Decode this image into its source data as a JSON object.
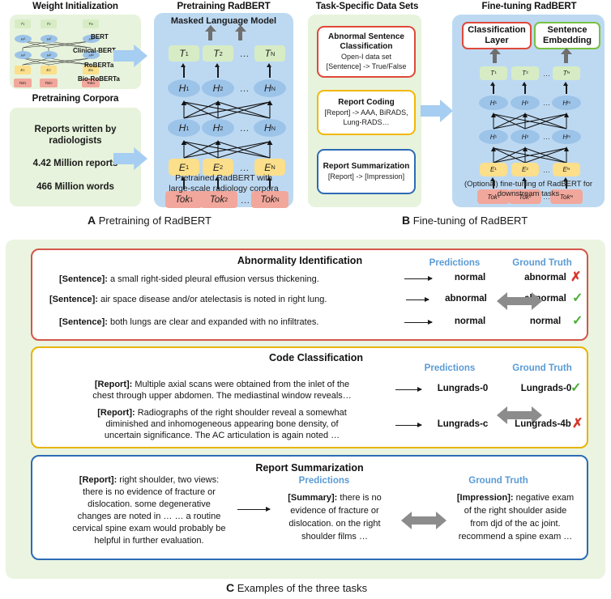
{
  "figure": {
    "panels": {
      "a": {
        "letter": "A",
        "caption": "Pretraining of RadBERT"
      },
      "b": {
        "letter": "B",
        "caption": "Fine-tuning of RadBERT"
      },
      "c": {
        "letter": "C",
        "caption": "Examples of the three tasks"
      }
    }
  },
  "colors": {
    "green_bg": "#e7f3dc",
    "blue_bg": "#bdd9f2",
    "arrow_blue": "#a6cdf2",
    "token_red": "#f2a79c",
    "embed_yellow": "#fbdf8a",
    "hidden_blue": "#9cc3e8",
    "output_green": "#d7ecc4",
    "header_blue": "#5a9bd5",
    "border_red": "#d4564a",
    "border_yellow": "#e8b306",
    "border_blue": "#2d6bb5",
    "check_green": "#4caf35",
    "cross_red": "#d4392b"
  },
  "weight_init": {
    "title": "Weight Initialization",
    "models": [
      "BERT",
      "Clinical-BERT",
      "RoBERTa",
      "Bio-RoBERTa"
    ],
    "node_rows": [
      [
        "T₁",
        "T₂",
        "Tₙ"
      ],
      [
        "H₁",
        "H₂",
        "Hₙ"
      ],
      [
        "H₁",
        "H₂",
        "Hₙ"
      ],
      [
        "E₁",
        "E₂",
        "Eₙ"
      ],
      [
        "Tok₁",
        "Tok₂",
        "Tokₙ"
      ]
    ]
  },
  "pretraining_corpora": {
    "title": "Pretraining Corpora",
    "lines": [
      "Reports written by",
      "radiologists",
      "4.42 Million reports",
      "466 Million words"
    ]
  },
  "pretraining_radbert": {
    "title": "Pretraining RadBERT",
    "mlm_label": "Masked Language Model",
    "rows": {
      "output": [
        "T",
        "T",
        "T"
      ],
      "hidden_top": [
        "H",
        "H",
        "H"
      ],
      "hidden_bottom": [
        "H",
        "H",
        "H"
      ],
      "embedding": [
        "E",
        "E",
        "E"
      ],
      "token": [
        "Tok",
        "Tok",
        "Tok"
      ]
    },
    "subscripts": [
      "1",
      "2",
      "N"
    ],
    "ellipsis": "…",
    "caption_lines": [
      "Pretrained RadBERT with",
      "large-scale radiology corpora"
    ]
  },
  "task_datasets": {
    "title": "Task-Specific Data Sets",
    "items": [
      {
        "heading_lines": [
          "Abnormal Sentence",
          "Classification"
        ],
        "sub_lines": [
          "Open-I data set",
          "[Sentence] -> True/False"
        ],
        "border": "red"
      },
      {
        "heading_lines": [
          "Report Coding"
        ],
        "sub_lines": [
          "[Report] -> AAA, BiRADS,",
          "Lung-RADS…"
        ],
        "border": "yellow"
      },
      {
        "heading_lines": [
          "Report Summarization"
        ],
        "sub_lines": [
          "[Report]  -> [Impression]"
        ],
        "border": "blue"
      }
    ]
  },
  "finetuning_radbert": {
    "title": "Fine-tuning RadBERT",
    "heads": [
      {
        "lines": [
          "Classification",
          "Layer"
        ],
        "border": "red"
      },
      {
        "lines": [
          "Sentence",
          "Embedding"
        ],
        "border": "green"
      }
    ],
    "caption_lines": [
      "(Optional) fine-tuning of RadBERT for",
      "downstream tasks"
    ]
  },
  "examples": {
    "col_predictions": "Predictions",
    "col_ground_truth": "Ground Truth",
    "tasks": [
      {
        "title": "Abnormality Identification",
        "border": "red",
        "rows": [
          {
            "input_label": "[Sentence]:",
            "input_text": " a small right-sided pleural effusion versus thickening.",
            "prediction": "normal",
            "ground_truth": "abnormal",
            "mark": "cross"
          },
          {
            "input_label": "[Sentence]:",
            "input_text": " air space disease and/or atelectasis is noted in right lung.",
            "prediction": "abnormal",
            "ground_truth": "abnormal",
            "mark": "check"
          },
          {
            "input_label": "[Sentence]:",
            "input_text": " both lungs are clear and expanded with no infiltrates.",
            "prediction": "normal",
            "ground_truth": "normal",
            "mark": "check"
          }
        ]
      },
      {
        "title": "Code Classification",
        "border": "yellow",
        "rows": [
          {
            "input_label": "[Report]:",
            "input_lines": [
              "  Multiple axial scans were obtained from the inlet of the",
              "chest through upper abdomen.  The mediastinal window reveals…"
            ],
            "prediction": "Lungrads-0",
            "ground_truth": "Lungrads-0",
            "mark": "check"
          },
          {
            "input_label": "[Report]:",
            "input_lines": [
              "  Radiographs of the right shoulder reveal a somewhat",
              "diminished and inhomogeneous appearing bone density, of",
              "uncertain significance. The AC articulation is again noted …"
            ],
            "prediction": "Lungrads-c",
            "ground_truth": "Lungrads-4b",
            "mark": "cross"
          }
        ]
      },
      {
        "title": "Report Summarization",
        "border": "blue",
        "rows": [
          {
            "input_label": "[Report]:",
            "input_lines": [
              " right shoulder, two views:",
              "there is no evidence of fracture or",
              "dislocation.  some degenerative",
              "changes are noted in … … a routine",
              "cervical spine exam would probably be",
              "helpful in further evaluation."
            ],
            "prediction_label": "[Summary]:",
            "prediction_lines": [
              " there is no",
              "evidence of fracture or",
              "dislocation. on the right",
              "shoulder films …"
            ],
            "ground_truth_label": "[Impression]:",
            "ground_truth_lines": [
              " negative exam",
              "of the right shoulder aside",
              "from djd of the ac joint.",
              "recommend a spine exam …"
            ],
            "mark": "none"
          }
        ]
      }
    ]
  }
}
